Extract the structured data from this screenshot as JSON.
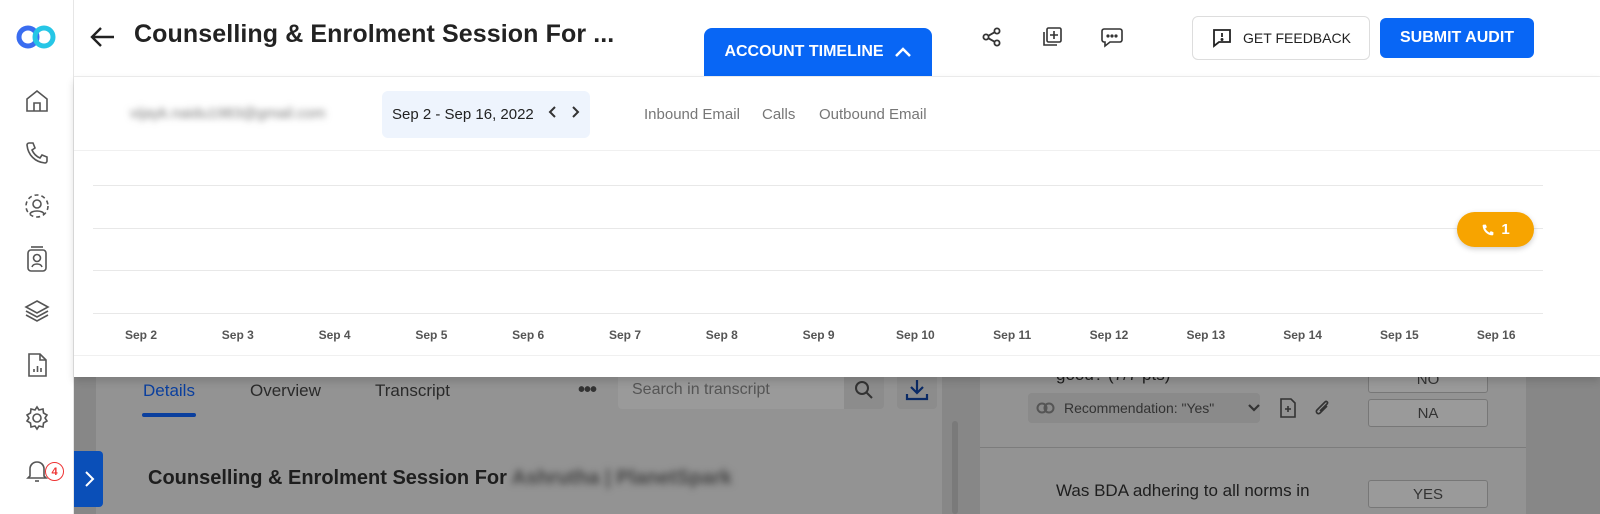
{
  "header": {
    "title": "Counselling & Enrolment Session For ...",
    "timeline_label": "ACCOUNT TIMELINE",
    "feedback_label": "GET FEEDBACK",
    "submit_label": "SUBMIT AUDIT"
  },
  "sidebar": {
    "items": [
      "home-icon",
      "phone-icon",
      "team-icon",
      "contact-card-icon",
      "layers-icon",
      "report-icon",
      "settings-icon",
      "bell-icon"
    ],
    "notification_count": "4"
  },
  "timeline": {
    "email": "vijayk.naidu1983@gmail.com",
    "date_range": "Sep 2 - Sep 16, 2022",
    "legend": [
      "Inbound Email",
      "Calls",
      "Outbound Email"
    ],
    "x_ticks": [
      "Sep 2",
      "Sep 3",
      "Sep 4",
      "Sep 5",
      "Sep 6",
      "Sep 7",
      "Sep 8",
      "Sep 9",
      "Sep 10",
      "Sep 11",
      "Sep 12",
      "Sep 13",
      "Sep 14",
      "Sep 15",
      "Sep 16"
    ],
    "call_count": "1"
  },
  "details": {
    "tabs": [
      "Details",
      "Overview",
      "Transcript"
    ],
    "search_placeholder": "Search in transcript",
    "section_title": "Counselling & Enrolment Session For",
    "section_title_blurred": "Ashrutha | PlanetSpark"
  },
  "audit": {
    "q1_text": "good? (7/7 pts)",
    "recommendation": "Recommendation: \"Yes\"",
    "q2_text": "Was BDA adhering to all norms in",
    "options": [
      "NO",
      "NA",
      "YES"
    ]
  },
  "colors": {
    "primary": "#0866f5",
    "call_marker": "#f7a400",
    "badge": "#ee3333"
  }
}
